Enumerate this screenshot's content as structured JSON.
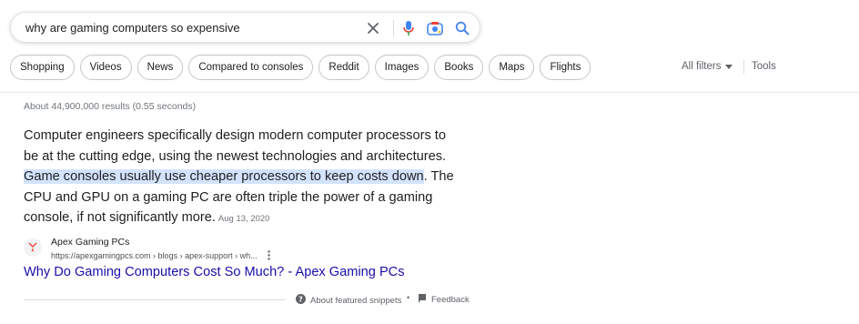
{
  "search": {
    "query": "why are gaming computers so expensive"
  },
  "chips": [
    "Shopping",
    "Videos",
    "News",
    "Compared to consoles",
    "Reddit",
    "Images",
    "Books",
    "Maps",
    "Flights"
  ],
  "filters": {
    "all_filters_label": "All filters",
    "tools_label": "Tools"
  },
  "stats": "About 44,900,000 results (0.55 seconds)",
  "featured_snippet": {
    "text_before": "Computer engineers specifically design modern computer processors to be at the cutting edge, using the newest technologies and architectures. ",
    "highlight": "Game consoles usually use cheaper processors to keep costs down",
    "text_after": ". The CPU and GPU on a gaming PC are often triple the power of a gaming console, if not significantly more.",
    "date": "Aug 13, 2020"
  },
  "source": {
    "site_name": "Apex Gaming PCs",
    "url_breadcrumb": "https://apexgamingpcs.com › blogs › apex-support › wh...",
    "title": "Why Do Gaming Computers Cost So Much? - Apex Gaming PCs"
  },
  "footer": {
    "about_label": "About featured snippets",
    "separator": "•",
    "feedback_label": "Feedback"
  },
  "colors": {
    "link": "#1a0dab",
    "highlight": "#d3e3fd",
    "mic_blue": "#4285f4",
    "mic_red": "#ea4335",
    "favicon_red": "#e8453c"
  }
}
